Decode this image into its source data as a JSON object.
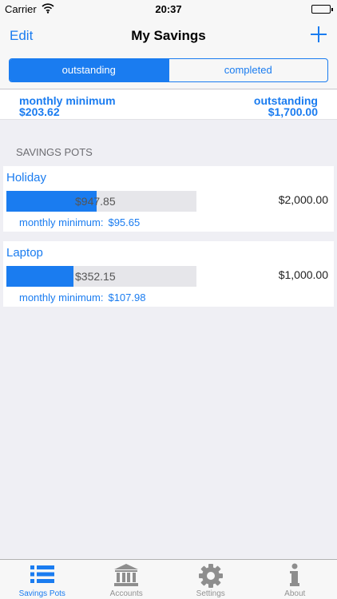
{
  "status_bar": {
    "carrier": "Carrier",
    "time": "20:37"
  },
  "nav": {
    "edit_label": "Edit",
    "title": "My Savings",
    "add_icon": "plus-icon"
  },
  "segments": [
    {
      "label": "outstanding",
      "selected": true
    },
    {
      "label": "completed",
      "selected": false
    }
  ],
  "summary": {
    "left_label": "monthly minimum",
    "left_value": "$203.62",
    "right_label": "outstanding",
    "right_value": "$1,700.00"
  },
  "section_header": "SAVINGS POTS",
  "pots": [
    {
      "name": "Holiday",
      "saved": "$947.85",
      "target": "$2,000.00",
      "progress": 0.474,
      "minimum_label": "monthly minimum:",
      "minimum_value": "$95.65"
    },
    {
      "name": "Laptop",
      "saved": "$352.15",
      "target": "$1,000.00",
      "progress": 0.352,
      "minimum_label": "monthly minimum:",
      "minimum_value": "$107.98"
    }
  ],
  "tab_bar": [
    {
      "label": "Savings Pots",
      "icon": "list-icon",
      "selected": true
    },
    {
      "label": "Accounts",
      "icon": "bank-icon",
      "selected": false
    },
    {
      "label": "Settings",
      "icon": "gear-icon",
      "selected": false
    },
    {
      "label": "About",
      "icon": "info-icon",
      "selected": false
    }
  ],
  "colors": {
    "accent": "#1a7cf0",
    "background": "#efeff4",
    "inactive_tab": "#929292"
  }
}
